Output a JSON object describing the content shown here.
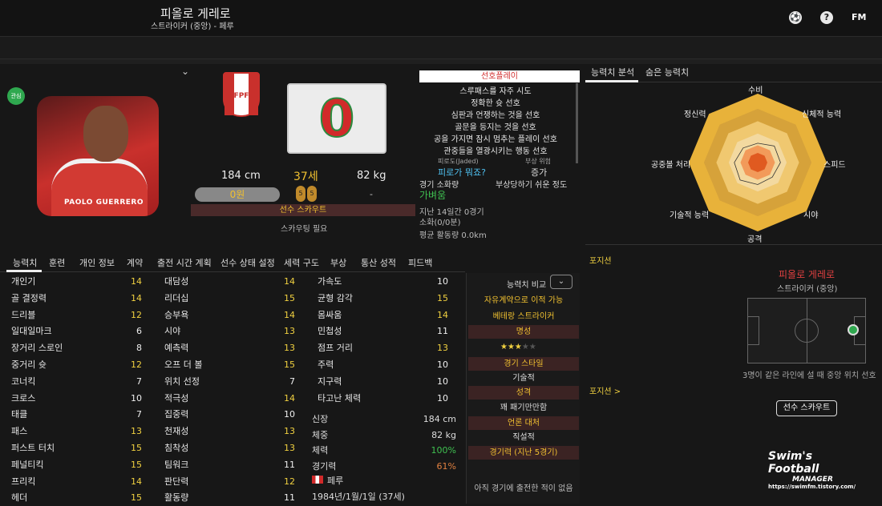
{
  "header": {
    "name": "피올로 게레로",
    "subtitle": "스트라이커 (중앙) - 페루",
    "fm_label": "FM",
    "icons": [
      "ball-icon",
      "help-icon"
    ]
  },
  "badge": {
    "label": "관심"
  },
  "photo": {
    "caption": "PAOLO GUERRERO"
  },
  "crest": {
    "text": "FPF"
  },
  "jersey": {
    "number": "0"
  },
  "bio": {
    "height": "184 cm",
    "age": "37세",
    "weight": "82 kg",
    "wage": "0원",
    "wage_dash": "-",
    "boots": [
      "5",
      "5"
    ],
    "scout_bar": "선수 스카우트",
    "scout_need": "스카우팅 필요"
  },
  "preferred": {
    "header": "선호플레이",
    "items": [
      "스루패스를 자주 시도",
      "정확한 슛 선호",
      "심판과 언쟁하는 것을 선호",
      "골문을 등지는 것을 선호",
      "공을 가지면 잠시 멈추는 플레이 선호",
      "관중들을 열광시키는 행동 선호"
    ]
  },
  "condition": {
    "jaded_label": "피로도(Jaded)",
    "jaded_value": "피로가 뭐죠?",
    "injury_label": "부상 위험",
    "injury_value": "증가",
    "match_fitness_label": "경기 소화량",
    "match_fitness_value": "가벼움",
    "injury_prone_label": "부상당하기 쉬운 정도",
    "last14": "지난 14일간 0경기",
    "sub": "소화(0/0분)",
    "avg_dist": "평균 활동량 0.0km"
  },
  "right_tabs": [
    "능력치 분석",
    "숨은 능력치"
  ],
  "radar": {
    "labels": [
      "수비",
      "신체적 능력",
      "스피드",
      "시야",
      "공격",
      "기술적 능력",
      "공중볼 처리",
      "정신력"
    ],
    "values": [
      0.28,
      0.34,
      0.33,
      0.3,
      0.32,
      0.36,
      0.34,
      0.3
    ]
  },
  "position": {
    "title": "포지션",
    "name": "피올로 게레로",
    "role": "스트라이커 (중앙)",
    "note": "3명이 같은 라인에 설 때 중앙 위치 선호",
    "arrow_label": "포지션 >",
    "scout_button": "선수 스카우트"
  },
  "main_tabs": [
    "능력치",
    "훈련",
    "개인 정보",
    "계약",
    "출전 시간 계획",
    "선수 상태 설정",
    "세력 구도",
    "부상",
    "통산 성적",
    "피드백"
  ],
  "attrs_col1": [
    [
      "개인기",
      "14"
    ],
    [
      "골 결정력",
      "14"
    ],
    [
      "드리블",
      "12"
    ],
    [
      "일대일마크",
      "6"
    ],
    [
      "장거리 스로인",
      "8"
    ],
    [
      "중거리 슛",
      "12"
    ],
    [
      "코너킥",
      "7"
    ],
    [
      "크로스",
      "10"
    ],
    [
      "태클",
      "7"
    ],
    [
      "패스",
      "13"
    ],
    [
      "퍼스트 터치",
      "15"
    ],
    [
      "페널티킥",
      "15"
    ],
    [
      "프리킥",
      "14"
    ],
    [
      "헤더",
      "15"
    ]
  ],
  "attrs_col2": [
    [
      "대담성",
      "14"
    ],
    [
      "리더십",
      "15"
    ],
    [
      "승부욕",
      "14"
    ],
    [
      "시야",
      "13"
    ],
    [
      "예측력",
      "13"
    ],
    [
      "오프 더 볼",
      "15"
    ],
    [
      "위치 선정",
      "7"
    ],
    [
      "적극성",
      "14"
    ],
    [
      "집중력",
      "10"
    ],
    [
      "천재성",
      "13"
    ],
    [
      "침착성",
      "13"
    ],
    [
      "팀워크",
      "11"
    ],
    [
      "판단력",
      "12"
    ],
    [
      "활동량",
      "11"
    ]
  ],
  "attrs_col3": [
    [
      "가속도",
      "10"
    ],
    [
      "균형 감각",
      "15"
    ],
    [
      "몸싸움",
      "14"
    ],
    [
      "민첩성",
      "11"
    ],
    [
      "점프 거리",
      "13"
    ],
    [
      "주력",
      "10"
    ],
    [
      "지구력",
      "10"
    ],
    [
      "타고난 체력",
      "10"
    ]
  ],
  "highlight_threshold": 11,
  "physical": [
    [
      "신장",
      "184 cm"
    ],
    [
      "체중",
      "82 kg"
    ],
    [
      "체력",
      "100%"
    ],
    [
      "경기력",
      "61%"
    ]
  ],
  "nation": "페루",
  "dob": "1984년/1월/1일 (37세)",
  "compare": {
    "label": "능력치 비교",
    "role1": "자유계약으로 이적 가능",
    "role2": "베테랑 스트라이커",
    "rep_header": "명성",
    "stars": "★★★",
    "stars_empty": "★★",
    "style_header": "경기 스타일",
    "style_value": "기술적",
    "pers_header": "성격",
    "pers_value": "꽤 패기만만함",
    "media_header": "언론 대처",
    "media_value": "직설적",
    "form_header": "경기력 (지난 5경기)",
    "form_value": "아직 경기에 출전한 적이 없음"
  },
  "watermark": {
    "line1": "Swim's Football",
    "line2": "MANAGER",
    "url": "https://swimfm.tistory.com/"
  },
  "colors": {
    "accent": "#f0d040",
    "red": "#d12a2a",
    "green": "#2fa84f"
  }
}
